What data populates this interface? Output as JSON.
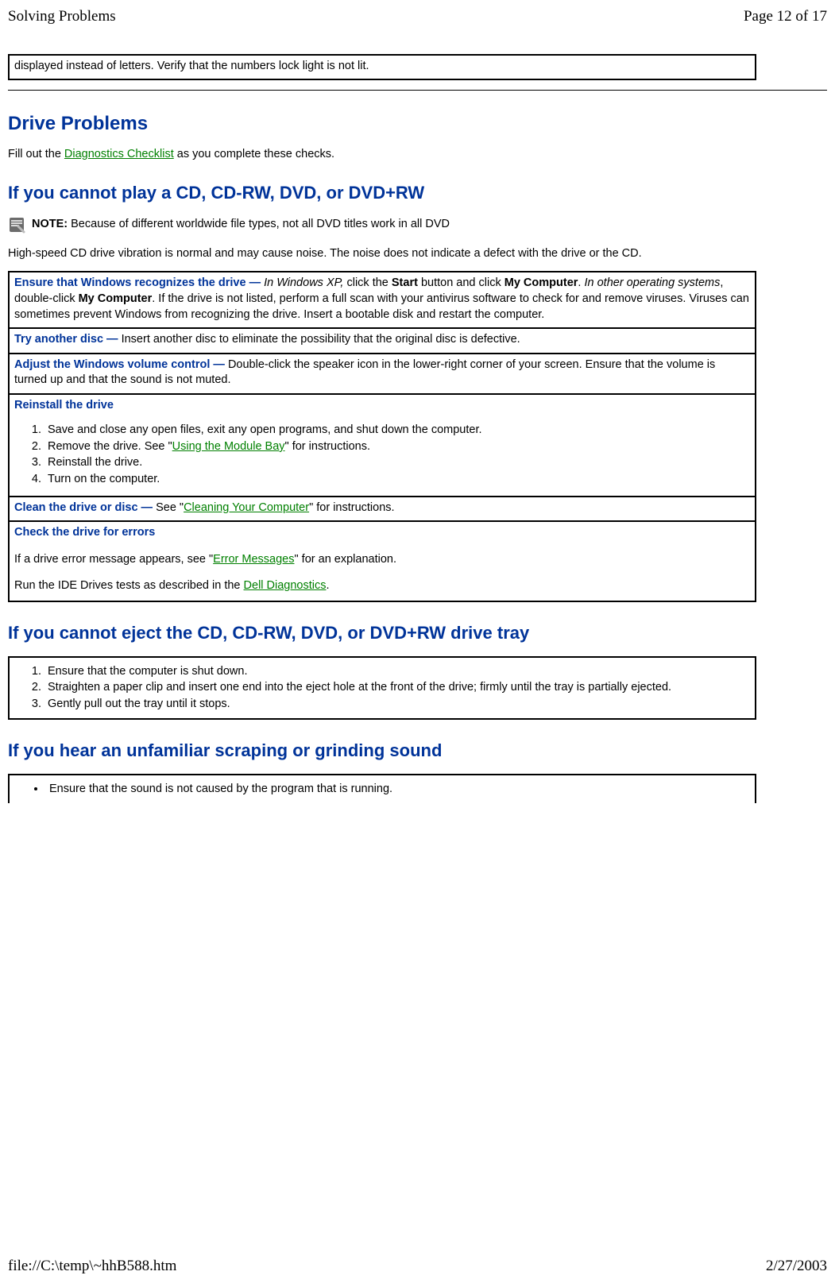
{
  "header": {
    "title": "Solving Problems",
    "page": "Page 12 of 17"
  },
  "footer": {
    "path": "file://C:\\temp\\~hhB588.htm",
    "date": "2/27/2003"
  },
  "topbox": {
    "text": "displayed instead of letters. Verify that the numbers lock light is not lit."
  },
  "section": {
    "title": "Drive Problems",
    "intro_pre": "Fill out the ",
    "intro_link": "Diagnostics Checklist",
    "intro_post": " as you complete these checks."
  },
  "sub1": {
    "title": "If you cannot play a CD, CD-RW, DVD, or DVD+RW",
    "note_label": "NOTE: ",
    "note_text": "Because of different worldwide file types, not all DVD titles work in all DVD",
    "para": "High-speed CD drive vibration is normal and may cause noise. The noise does not indicate a defect with the drive or the CD.",
    "rows": {
      "r1": {
        "lead": "Ensure that Windows recognizes the drive — ",
        "t1": "In Windows XP,",
        "t2": " click the ",
        "b1": "Start",
        "t3": " button and click ",
        "b2": "My Computer",
        "t4": ". ",
        "t5": "In other operating systems",
        "t6": ", double-click ",
        "b3": "My Computer",
        "t7": ". If the drive is not listed, perform a full scan with your antivirus software to check for and remove viruses. Viruses can sometimes prevent Windows from recognizing the drive. Insert a bootable disk and restart the computer."
      },
      "r2": {
        "lead": "Try another disc — ",
        "text": "Insert another disc to eliminate the possibility that the original disc is defective."
      },
      "r3": {
        "lead": "Adjust the Windows volume control — ",
        "text": "Double-click the speaker icon in the lower-right corner of your screen. Ensure that the volume is turned up and that the sound is not muted."
      },
      "r4": {
        "lead": "Reinstall the drive",
        "li1": "Save and close any open files, exit any open programs, and shut down the computer.",
        "li2_pre": "Remove the drive. See \"",
        "li2_link": "Using the Module Bay",
        "li2_post": "\" for instructions.",
        "li3": "Reinstall the drive.",
        "li4": "Turn on the computer."
      },
      "r5": {
        "lead": "Clean the drive or disc — ",
        "pre": "See \"",
        "link": "Cleaning Your Computer",
        "post": "\" for instructions."
      },
      "r6": {
        "lead": "Check the drive for errors",
        "p1_pre": "If a drive error message appears, see \"",
        "p1_link": "Error Messages",
        "p1_post": "\" for an explanation.",
        "p2_pre": "Run the IDE Drives tests as described in the ",
        "p2_link": "Dell Diagnostics",
        "p2_post": "."
      }
    }
  },
  "sub2": {
    "title": "If you cannot eject the CD, CD-RW, DVD, or DVD+RW drive tray",
    "li1": "Ensure that the computer is shut down.",
    "li2": "Straighten a paper clip and insert one end into the eject hole at the front of the drive; firmly until the tray is partially ejected.",
    "li3": "Gently pull out the tray until it stops."
  },
  "sub3": {
    "title": "If you hear an unfamiliar scraping or grinding sound",
    "li1": "Ensure that the sound is not caused by the program that is running."
  }
}
